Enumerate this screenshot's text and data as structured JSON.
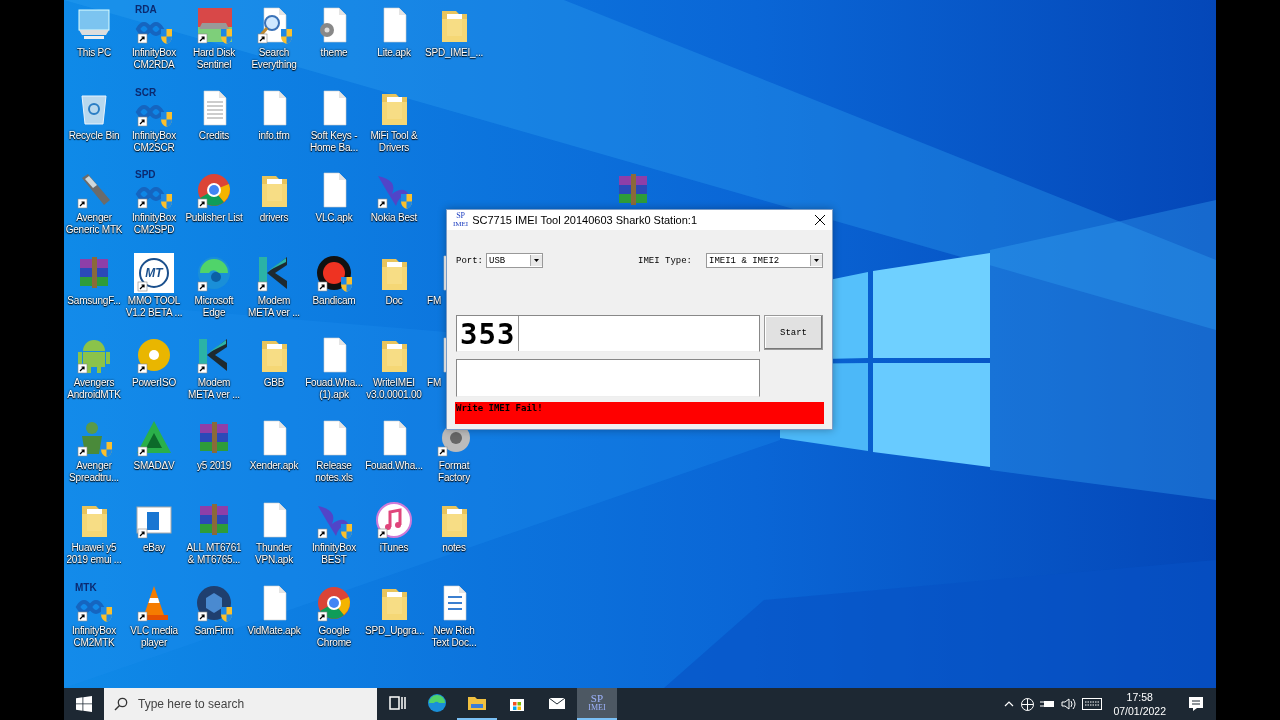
{
  "desktop": {
    "icons": [
      {
        "kind": "computer",
        "label": "This PC",
        "shortcut": false
      },
      {
        "kind": "recycle",
        "label": "Recycle Bin",
        "shortcut": false
      },
      {
        "kind": "phone",
        "label": "Avenger Generic MTK",
        "shortcut": true
      },
      {
        "kind": "winrar",
        "label": "SamsungF...",
        "shortcut": false
      },
      {
        "kind": "android",
        "label": "Avengers AndroidMTK",
        "shortcut": true
      },
      {
        "kind": "avenger",
        "label": "Avenger Spreadtru...",
        "shortcut": true
      },
      {
        "kind": "folder",
        "label": "Huawei y5 2019 emui ...",
        "shortcut": false
      },
      {
        "kind": "infinity",
        "badge": "MTK",
        "label": "InfinityBox CM2MTK",
        "shortcut": true
      },
      {
        "kind": "infinity",
        "badge": "RDA",
        "label": "InfinityBox CM2RDA",
        "shortcut": true
      },
      {
        "kind": "infinity",
        "badge": "SCR",
        "label": "InfinityBox CM2SCR",
        "shortcut": true
      },
      {
        "kind": "infinity",
        "badge": "SPD",
        "label": "InfinityBox CM2SPD",
        "shortcut": true
      },
      {
        "kind": "mt",
        "badge": "MT",
        "label": "MMO TOOL V1.2 BETA ...",
        "shortcut": true
      },
      {
        "kind": "disc",
        "label": "PowerISO",
        "shortcut": true
      },
      {
        "kind": "smadav",
        "label": "SMADΔV",
        "shortcut": true
      },
      {
        "kind": "ebay",
        "label": "eBay",
        "shortcut": true
      },
      {
        "kind": "vlc",
        "label": "VLC media player",
        "shortcut": true
      },
      {
        "kind": "disk",
        "label": "Hard Disk Sentinel",
        "shortcut": true
      },
      {
        "kind": "textdoc",
        "label": "Credits",
        "shortcut": false
      },
      {
        "kind": "chrome",
        "label": "Publisher List",
        "shortcut": true
      },
      {
        "kind": "edge",
        "label": "Microsoft Edge",
        "shortcut": true
      },
      {
        "kind": "modem",
        "label": "Modem META ver ...",
        "shortcut": true
      },
      {
        "kind": "winrar",
        "label": "y5 2019",
        "shortcut": false
      },
      {
        "kind": "winrar",
        "label": "ALL MT6761 & MT6765...",
        "shortcut": false
      },
      {
        "kind": "samfirm",
        "label": "SamFirm",
        "shortcut": true
      },
      {
        "kind": "search",
        "label": "Search Everything",
        "shortcut": true
      },
      {
        "kind": "doc",
        "label": "info.tfm",
        "shortcut": false
      },
      {
        "kind": "folder",
        "label": "drivers",
        "shortcut": false
      },
      {
        "kind": "modem",
        "label": "Modem META ver ...",
        "shortcut": true
      },
      {
        "kind": "folder",
        "label": "GBB",
        "shortcut": false
      },
      {
        "kind": "doc",
        "label": "Xender.apk",
        "shortcut": false
      },
      {
        "kind": "doc",
        "label": "Thunder VPN.apk",
        "shortcut": false
      },
      {
        "kind": "doc",
        "label": "VidMate.apk",
        "shortcut": false
      },
      {
        "kind": "gear-doc",
        "label": "theme",
        "shortcut": false
      },
      {
        "kind": "doc",
        "label": "Soft Keys - Home Ba...",
        "shortcut": false
      },
      {
        "kind": "doc",
        "label": "VLC.apk",
        "shortcut": false
      },
      {
        "kind": "bandicam",
        "label": "Bandicam",
        "shortcut": true
      },
      {
        "kind": "doc",
        "label": "Fouad.Wha... (1).apk",
        "shortcut": false
      },
      {
        "kind": "doc",
        "label": "Release notes.xls",
        "shortcut": false
      },
      {
        "kind": "swirl",
        "label": "InfinityBox BEST",
        "shortcut": true
      },
      {
        "kind": "chrome",
        "label": "Google Chrome",
        "shortcut": true
      },
      {
        "kind": "doc",
        "label": "Lite.apk",
        "shortcut": false
      },
      {
        "kind": "folder",
        "label": "MiFi Tool & Drivers",
        "shortcut": false
      },
      {
        "kind": "swirl",
        "label": "Nokia Best",
        "shortcut": true
      },
      {
        "kind": "folder",
        "label": "Doc",
        "shortcut": false
      },
      {
        "kind": "folder",
        "label": "WriteIMEI v3.0.0001.00",
        "shortcut": false
      },
      {
        "kind": "doc",
        "label": "Fouad.Wha...",
        "shortcut": false
      },
      {
        "kind": "itunes",
        "label": "iTunes",
        "shortcut": true
      },
      {
        "kind": "folder",
        "label": "SPD_Upgra...",
        "shortcut": false
      },
      {
        "kind": "folder",
        "label": "SPD_IMEI_...",
        "shortcut": false
      },
      {
        "kind": "blank"
      },
      {
        "kind": "blank"
      },
      {
        "kind": "doc",
        "label": "FM",
        "shortcut": false,
        "cut": true
      },
      {
        "kind": "doc",
        "label": "FM",
        "shortcut": false,
        "cut": true
      },
      {
        "kind": "formatfactory",
        "label": "Format Factory",
        "shortcut": true
      },
      {
        "kind": "folder",
        "label": "notes",
        "shortcut": false
      },
      {
        "kind": "richtext",
        "label": "New Rich Text Doc...",
        "shortcut": false
      }
    ],
    "loose_icons": [
      {
        "kind": "winrar",
        "shortcut": false
      }
    ]
  },
  "dialog": {
    "icon_text": [
      "SP",
      "IMEI"
    ],
    "title": "SC7715 IMEI Tool 20140603 Shark0 Station:1",
    "port": {
      "label": "Port:",
      "value": "USB"
    },
    "imei_type": {
      "label": "IMEI Type:",
      "value": "IMEI1 & IMEI2"
    },
    "imei_value": "353",
    "start_button": "Start",
    "status": "Write IMEI Fail!"
  },
  "taskbar": {
    "search_placeholder": "Type here to search",
    "apps": [
      {
        "kind": "taskview",
        "open": false,
        "selected": false
      },
      {
        "kind": "edge",
        "open": false,
        "selected": false
      },
      {
        "kind": "explorer",
        "open": true,
        "selected": false
      },
      {
        "kind": "store",
        "open": false,
        "selected": false
      },
      {
        "kind": "mail",
        "open": false,
        "selected": false
      },
      {
        "kind": "sp",
        "text": [
          "SP",
          "IMEI"
        ],
        "open": true,
        "selected": true
      }
    ],
    "time": "17:58",
    "date": "07/01/2022"
  }
}
